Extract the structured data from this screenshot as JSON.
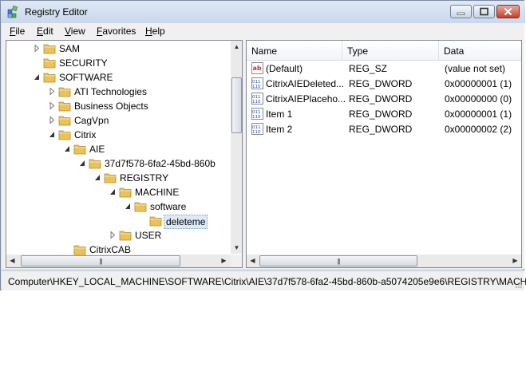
{
  "window": {
    "title": "Registry Editor",
    "menu": [
      {
        "label": "File"
      },
      {
        "label": "Edit"
      },
      {
        "label": "View"
      },
      {
        "label": "Favorites"
      },
      {
        "label": "Help"
      }
    ]
  },
  "tree": {
    "nodes": [
      {
        "label": "SAM",
        "expander": "collapsed"
      },
      {
        "label": "SECURITY",
        "expander": "none"
      },
      {
        "label": "SOFTWARE",
        "expander": "expanded"
      },
      {
        "label": "ATI Technologies",
        "expander": "collapsed"
      },
      {
        "label": "Business Objects",
        "expander": "collapsed"
      },
      {
        "label": "CagVpn",
        "expander": "collapsed"
      },
      {
        "label": "Citrix",
        "expander": "expanded"
      },
      {
        "label": "AIE",
        "expander": "expanded"
      },
      {
        "label": "37d7f578-6fa2-45bd-860b",
        "expander": "expanded"
      },
      {
        "label": "REGISTRY",
        "expander": "expanded"
      },
      {
        "label": "MACHINE",
        "expander": "expanded"
      },
      {
        "label": "software",
        "expander": "expanded"
      },
      {
        "label": "deleteme",
        "expander": "none",
        "selected": true
      },
      {
        "label": "USER",
        "expander": "collapsed"
      },
      {
        "label": "CitrixCAB",
        "expander": "none"
      }
    ]
  },
  "list": {
    "columns": [
      {
        "label": "Name"
      },
      {
        "label": "Type"
      },
      {
        "label": "Data"
      }
    ],
    "rows": [
      {
        "name": "(Default)",
        "type": "REG_SZ",
        "data": "(value not set)",
        "icon": "string-value-icon"
      },
      {
        "name": "CitrixAIEDeleted...",
        "type": "REG_DWORD",
        "data": "0x00000001 (1)",
        "icon": "binary-value-icon"
      },
      {
        "name": "CitrixAIEPlaceho...",
        "type": "REG_DWORD",
        "data": "0x00000000 (0)",
        "icon": "binary-value-icon"
      },
      {
        "name": "Item 1",
        "type": "REG_DWORD",
        "data": "0x00000001 (1)",
        "icon": "binary-value-icon"
      },
      {
        "name": "Item 2",
        "type": "REG_DWORD",
        "data": "0x00000002 (2)",
        "icon": "binary-value-icon"
      }
    ]
  },
  "status": {
    "path": "Computer\\HKEY_LOCAL_MACHINE\\SOFTWARE\\Citrix\\AIE\\37d7f578-6fa2-45bd-860b-a5074205e9e6\\REGISTRY\\MACHI"
  },
  "colors": {
    "selection": "#dce9f7",
    "folder": "#e9c25a",
    "titlebar": "#c9d8ea",
    "close": "#c4412a"
  }
}
